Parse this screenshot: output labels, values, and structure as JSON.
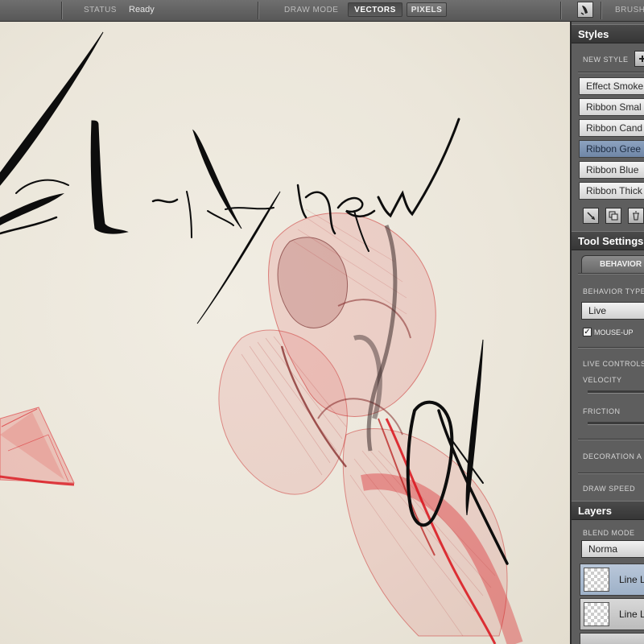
{
  "toolbar": {
    "status_label": "STATUS",
    "status_value": "Ready",
    "draw_mode_label": "DRAW MODE",
    "vectors_label": "VECTORS",
    "pixels_label": "PIXELS",
    "brush_label": "BRUSH"
  },
  "styles_panel": {
    "title": "Styles",
    "new_style_label": "NEW STYLE",
    "items": [
      {
        "label": "Effect Smoke"
      },
      {
        "label": "Ribbon Smal"
      },
      {
        "label": "Ribbon Cand"
      },
      {
        "label": "Ribbon Gree"
      },
      {
        "label": "Ribbon Blue"
      },
      {
        "label": "Ribbon Thick"
      }
    ],
    "selected_index": 3
  },
  "tool_settings": {
    "title": "Tool Settings",
    "tab_label": "BEHAVIOR",
    "behavior_type_label": "BEHAVIOR TYPE",
    "behavior_type_value": "Live",
    "mouse_up_label": "MOUSE-UP",
    "mouse_up_checked": true,
    "live_controls_label": "LIVE CONTROLS",
    "velocity_label": "VELOCITY",
    "friction_label": "FRICTION",
    "decoration_label": "DECORATION A",
    "draw_speed_label": "DRAW SPEED"
  },
  "layers_panel": {
    "title": "Layers",
    "blend_mode_label": "BLEND MODE",
    "blend_mode_value": "Norma",
    "layers": [
      {
        "name": "Line L"
      },
      {
        "name": "Line L"
      }
    ],
    "selected_index": 0
  },
  "colors": {
    "ink": "#0d0d0d",
    "ribbon_red": "#d9121a",
    "selection_blue": "#7a8fae"
  }
}
